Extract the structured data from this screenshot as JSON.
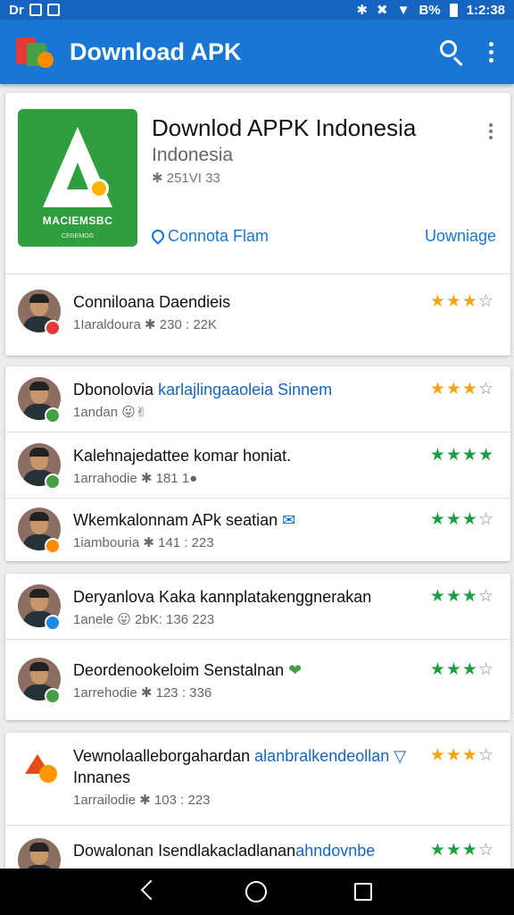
{
  "status_bar": {
    "left_text": "Dr",
    "battery": "B%",
    "time": "1:2:38"
  },
  "app_bar": {
    "title": "Download APK"
  },
  "hero": {
    "title": "Downlod APPK Indonesia",
    "subtitle": "Indonesia",
    "meta": "✱ 251VI 33",
    "icon_caption": "MACIEMSBC",
    "icon_subcaption": "CEREMOG",
    "location_link": "Connota Flam",
    "download_label": "Uowniage"
  },
  "reviews": [
    {
      "title": "Conniloana Daendieis",
      "title_accent": "",
      "meta": "1Iaraldoura  ✱ 230 : 22K",
      "rating_filled": 3,
      "star_color": "orange",
      "badge": "red"
    },
    {
      "title": "Dbonolovia ",
      "title_accent": "karlajlingaaoleia Sinnem",
      "meta": "1andan 😛✌",
      "rating_filled": 3,
      "star_color": "orange",
      "badge": "green"
    },
    {
      "title": "Kalehnajedattee komar honiat.",
      "title_accent": "",
      "meta": "1arrahodie  ✱ 181   1●",
      "rating_filled": 4,
      "star_color": "green",
      "badge": "green"
    },
    {
      "title": "Wkemkalonnam APk seatian ",
      "title_accent": "✉",
      "meta": "1iambouria  ✱ 141 : 223",
      "rating_filled": 3,
      "star_color": "green",
      "badge": "orange"
    },
    {
      "title": "Deryanlova Kaka kannplatakenggnerakan",
      "title_accent": "",
      "meta": "1anele 😛 2bK: 136   223",
      "rating_filled": 3,
      "star_color": "green",
      "badge": "blue"
    },
    {
      "title": "Deordenookeloim Senstalnan ",
      "title_accent": "❤",
      "meta": "1arrehodie  ✱ 123 : 336",
      "rating_filled": 3,
      "star_color": "green",
      "badge": "green"
    },
    {
      "title": "Vewnolaalleborgahardan ",
      "title_accent": "alanbralkendeollan ▽",
      "title_line2": "Innanes",
      "meta": "1arrailodie  ✱ 103 : 223",
      "rating_filled": 3,
      "star_color": "orange"
    },
    {
      "title": "Dowalonan Isendlakacladlanan",
      "title_accent": "ahndovnbe",
      "meta": "",
      "rating_filled": 3,
      "star_color": "green",
      "badge": "green"
    }
  ],
  "icons": {
    "search": "search-icon",
    "more": "more-vert-icon",
    "back": "back-icon",
    "home": "home-icon",
    "recent": "recent-apps-icon"
  },
  "colors": {
    "primary": "#1976d2",
    "status": "#1565c0",
    "star_orange": "#f2a619",
    "star_green": "#1e9e44"
  }
}
